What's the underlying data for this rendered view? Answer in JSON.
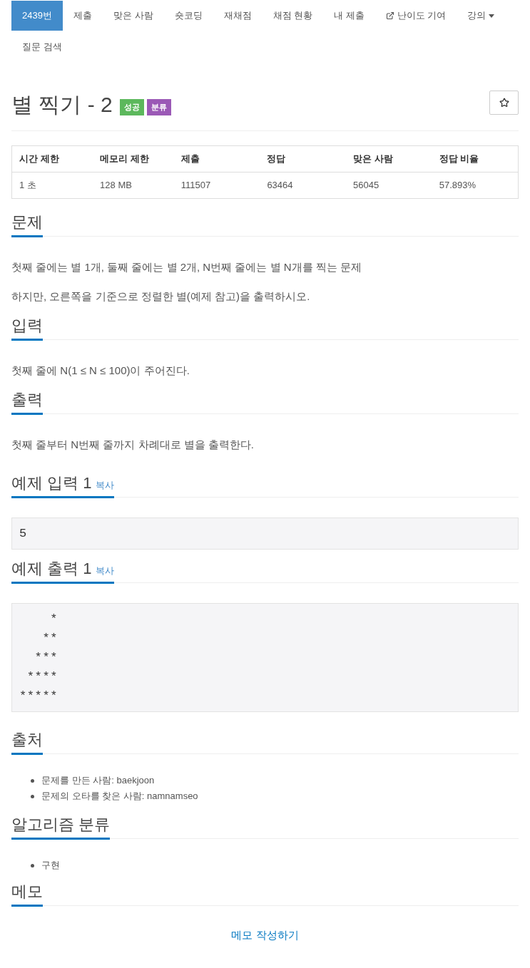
{
  "nav": {
    "tabs": [
      {
        "label": "2439번",
        "kind": "link",
        "selected": true
      },
      {
        "label": "제출",
        "kind": "link",
        "selected": false
      },
      {
        "label": "맞은 사람",
        "kind": "link",
        "selected": false
      },
      {
        "label": "숏코딩",
        "kind": "link",
        "selected": false
      },
      {
        "label": "재채점",
        "kind": "link",
        "selected": false
      },
      {
        "label": "채점 현황",
        "kind": "link",
        "selected": false
      },
      {
        "label": "내 제출",
        "kind": "link",
        "selected": false
      },
      {
        "label": "난이도 기여",
        "kind": "external",
        "selected": false
      },
      {
        "label": "강의",
        "kind": "dropdown",
        "selected": false
      },
      {
        "label": "질문 검색",
        "kind": "link",
        "selected": false
      }
    ]
  },
  "problem": {
    "title": "별 찍기 - 2",
    "badges": [
      {
        "label": "성공",
        "color": "#5cb85c"
      },
      {
        "label": "분류",
        "color": "#9b59b6"
      }
    ]
  },
  "table": {
    "columns": [
      "시간 제한",
      "메모리 제한",
      "제출",
      "정답",
      "맞은 사람",
      "정답 비율"
    ],
    "rows": [
      [
        "1 초",
        "128 MB",
        "111507",
        "63464",
        "56045",
        "57.893%"
      ]
    ]
  },
  "sections": [
    {
      "kind": "text",
      "title": "문제",
      "paragraphs": [
        "첫째 줄에는 별 1개, 둘째 줄에는 별 2개, N번째 줄에는 별 N개를 찍는 문제",
        "하지만, 오른쪽을 기준으로 정렬한 별(예제 참고)을 출력하시오."
      ]
    },
    {
      "kind": "text",
      "title": "입력",
      "paragraphs": [
        "첫째 줄에 N(1 ≤ N ≤ 100)이 주어진다."
      ]
    },
    {
      "kind": "text",
      "title": "출력",
      "paragraphs": [
        "첫째 줄부터 N번째 줄까지 차례대로 별을 출력한다."
      ]
    },
    {
      "kind": "sample",
      "title": "예제 입력 1",
      "copy": "복사",
      "content": "5"
    },
    {
      "kind": "sample",
      "title": "예제 출력 1",
      "copy": "복사",
      "content": "    *\n   **\n  ***\n ****\n*****"
    },
    {
      "kind": "list",
      "title": "출처",
      "items": [
        "문제를 만든 사람: baekjoon",
        "문제의 오타를 찾은 사람: namnamseo"
      ]
    },
    {
      "kind": "list",
      "title": "알고리즘 분류",
      "items": [
        "구현"
      ]
    },
    {
      "kind": "memo",
      "title": "메모",
      "link": "메모 작성하기"
    }
  ]
}
